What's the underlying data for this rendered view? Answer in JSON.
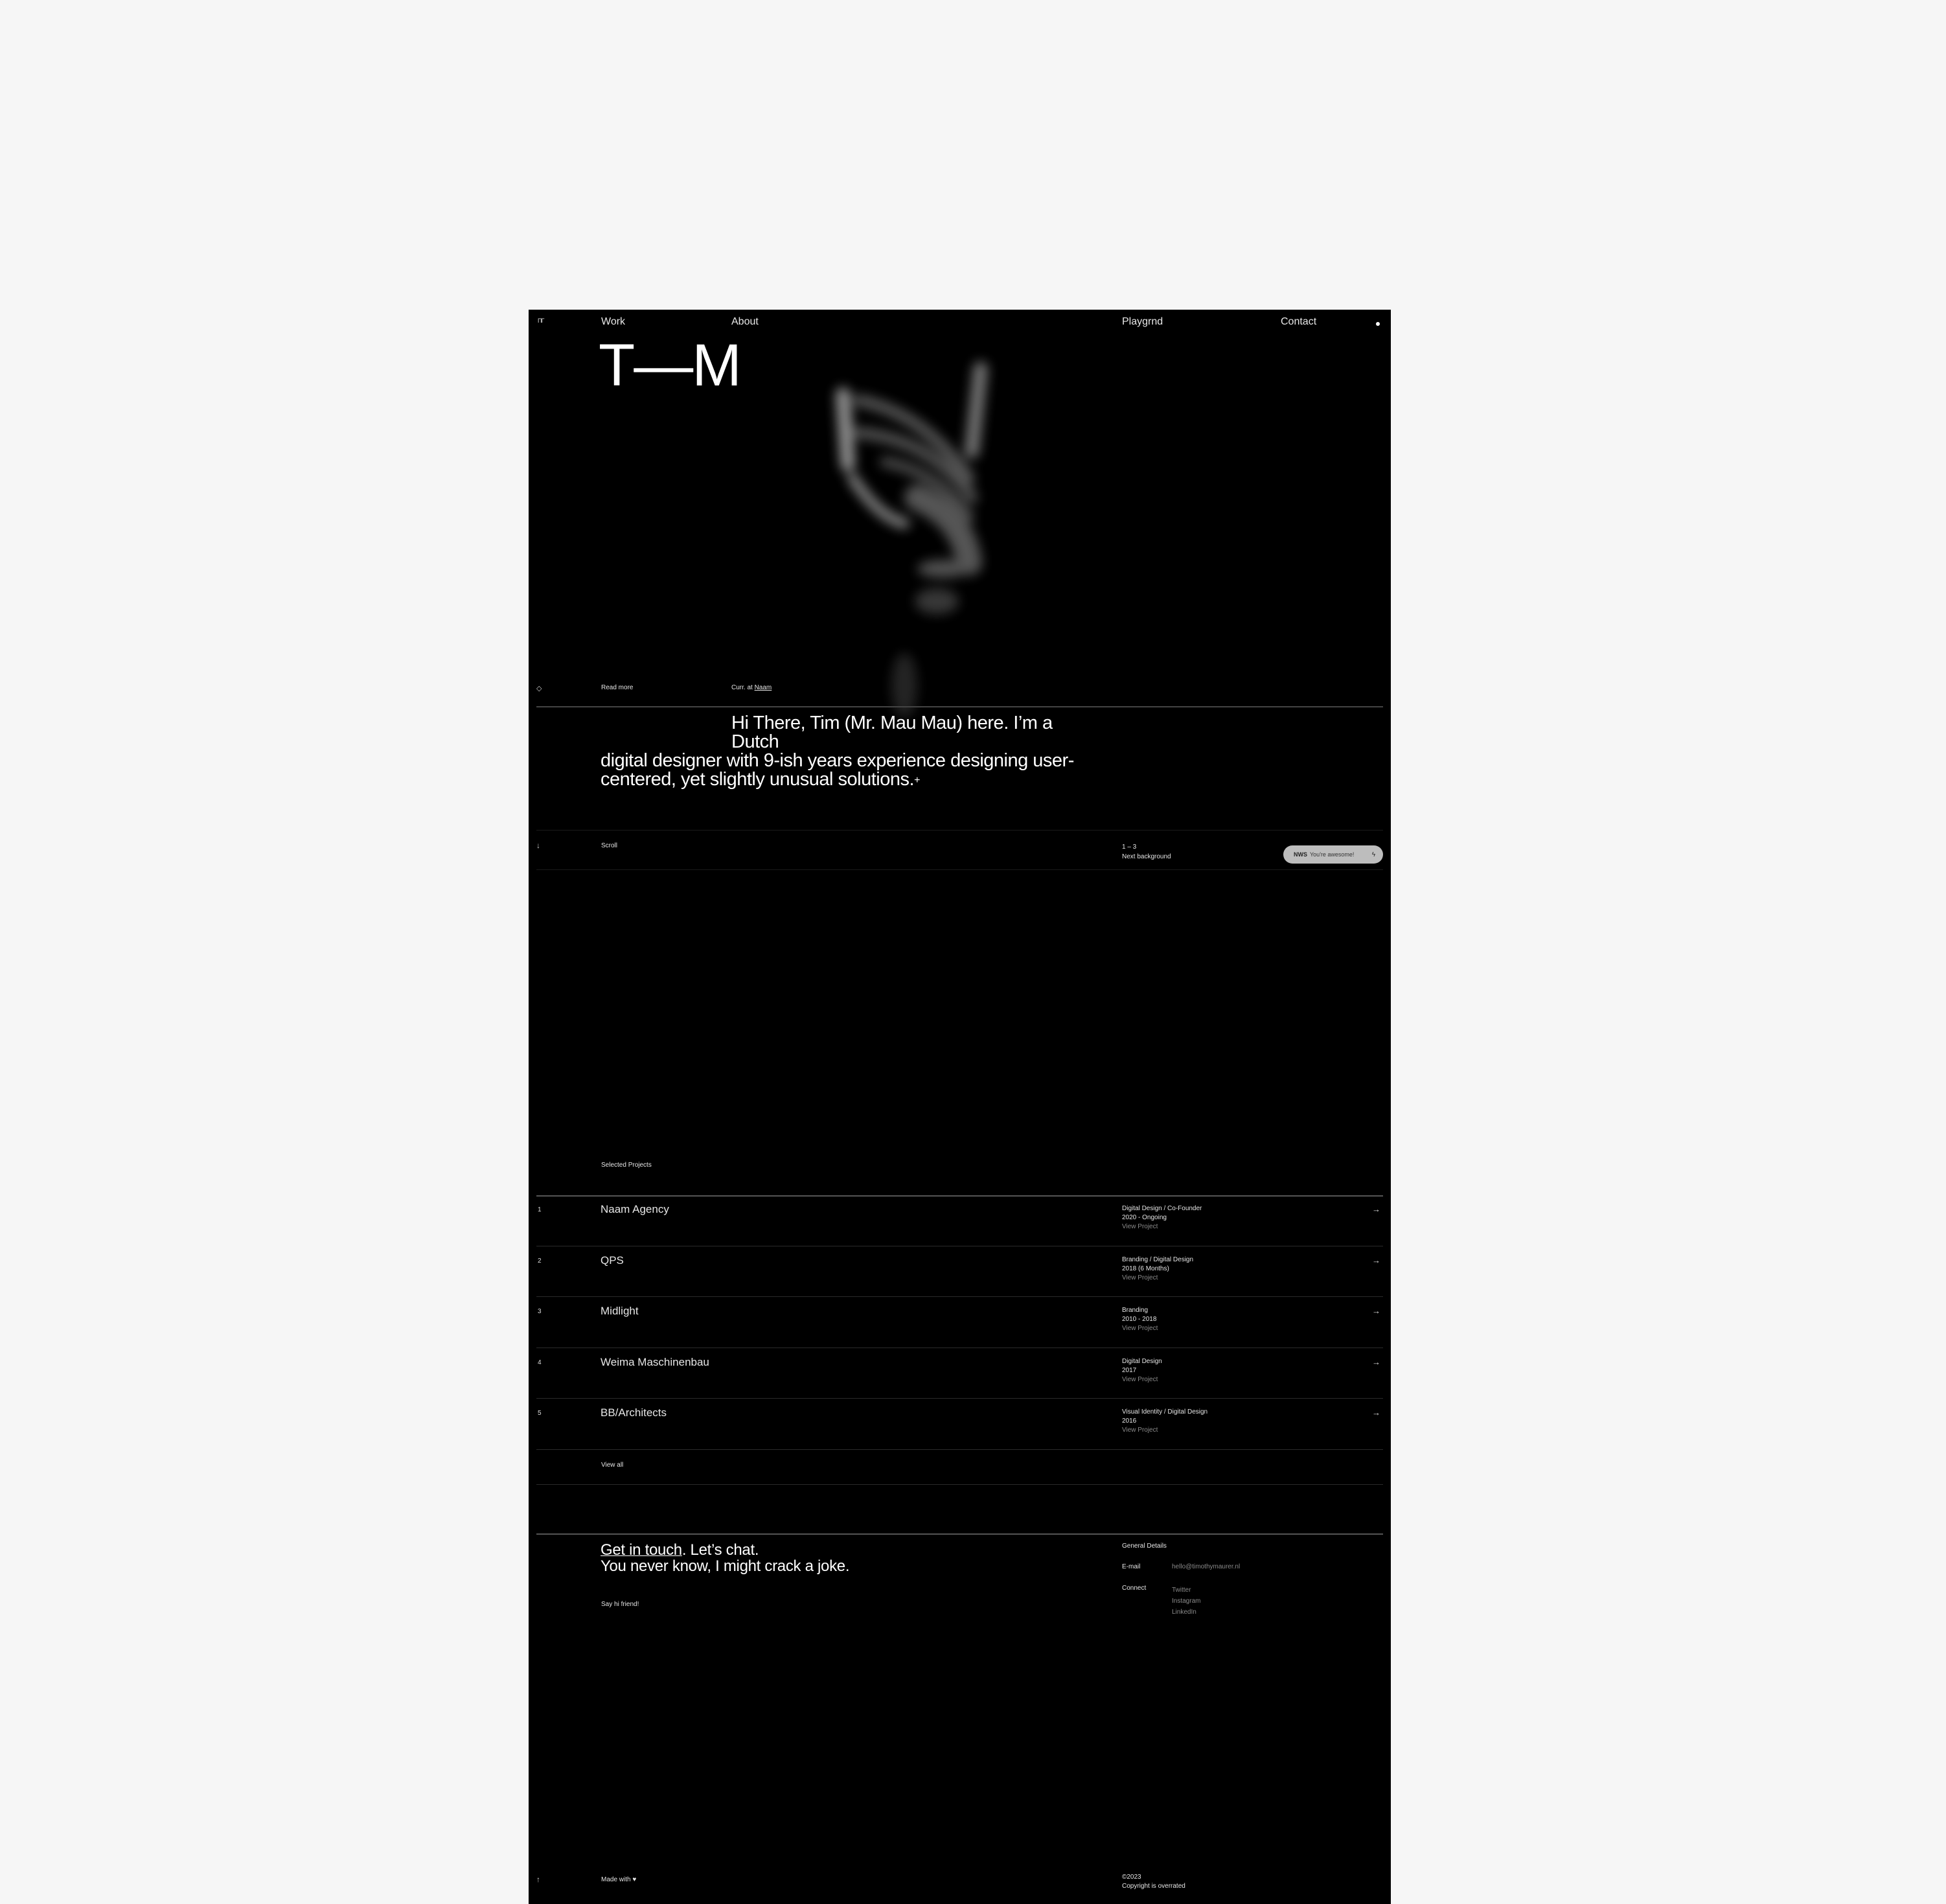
{
  "nav": {
    "logo_icon": "tm-logo-icon",
    "items": [
      {
        "label": "Work"
      },
      {
        "label": "About"
      },
      {
        "label": "Playgrnd"
      },
      {
        "label": "Contact"
      }
    ],
    "menu_dot_icon": "dot-icon"
  },
  "hero": {
    "title": "T—M",
    "eye_icon": "eye-icon",
    "read_more": "Read more",
    "current_prefix": "Curr. at",
    "current_link": "Naam",
    "intro": "Hi There, Tim (Mr. Mau Mau) here. I’m a Dutch digital designer with 9-ish years experience designing user-centered, yet slightly unusual solutions.",
    "intro_lines": [
      "Hi There, Tim (Mr. Mau Mau) here. I’m a Dutch",
      "digital designer with 9-ish years experience designing user-",
      "centered, yet slightly unusual solutions."
    ],
    "plus": "+"
  },
  "scrollbar_row": {
    "arrow_icon": "arrow-down-icon",
    "scroll_label": "Scroll",
    "bg_counter": "1 – 3",
    "bg_label": "Next background",
    "pill": {
      "brand": "NWS",
      "text": "You're awesome!",
      "icon": "bolt-icon"
    }
  },
  "projects": {
    "heading": "Selected Projects",
    "items": [
      {
        "num": "1",
        "title": "Naam Agency",
        "discipline": "Digital Design / Co-Founder",
        "period": "2020 - Ongoing",
        "cta": "View Project"
      },
      {
        "num": "2",
        "title": "QPS",
        "discipline": "Branding / Digital Design",
        "period": "2018 (6 Months)",
        "cta": "View Project"
      },
      {
        "num": "3",
        "title": "Midlight",
        "discipline": "Branding",
        "period": "2010 - 2018",
        "cta": "View Project"
      },
      {
        "num": "4",
        "title": "Weima Maschinenbau",
        "discipline": "Digital Design",
        "period": "2017",
        "cta": "View Project"
      },
      {
        "num": "5",
        "title": "BB/Architects",
        "discipline": "Visual Identity / Digital Design",
        "period": "2016",
        "cta": "View Project"
      }
    ],
    "view_all": "View all"
  },
  "contact": {
    "headline_link": "Get in touch",
    "headline_rest": ". Let’s chat.",
    "headline_line2": "You never know, I might crack a joke.",
    "say_hi": "Say hi friend!",
    "details_heading": "General Details",
    "email_label": "E-mail",
    "email_value": "hello@timothymaurer.nl",
    "connect_label": "Connect",
    "social": [
      "Twitter",
      "Instagram",
      "LinkedIn"
    ]
  },
  "footer": {
    "up_icon": "arrow-up-icon",
    "made_with": "Made with",
    "heart_icon": "heart-icon",
    "year": "©2023",
    "copyright": "Copyright is overrated"
  }
}
